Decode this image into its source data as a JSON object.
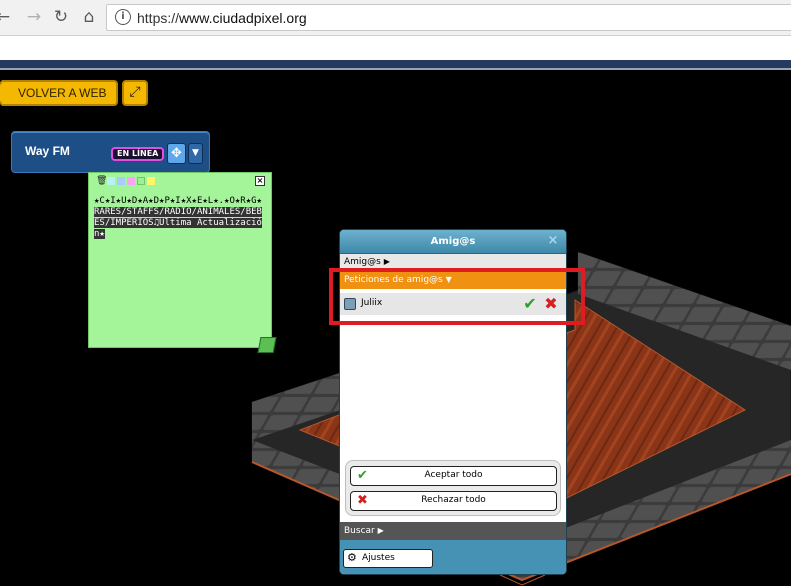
{
  "browser": {
    "back_icon": "arrow-left-icon",
    "forward_icon": "arrow-right-icon",
    "reload_icon": "reload-icon",
    "home_icon": "home-icon",
    "url_scheme": "https://",
    "url_host": "www.ciudadpixel.org"
  },
  "toolbar": {
    "back_to_web_label": "VOLVER A WEB",
    "expand_icon": "expand-arrows-icon"
  },
  "radio": {
    "station_name": "Way FM",
    "status_badge": "EN LÍNEA"
  },
  "note": {
    "line1": "★C★I★U★D★A★D★P★I★X★E★L★.★O★R★G★",
    "line2_highlight": "RARES/STAFFS/RADIO/ANIMALES/BEBES/IMPERIOS♫Ultima Actualización★",
    "swatch_colors": [
      "#b7f2f2",
      "#a9c9ff",
      "#f7a6f2",
      "#a4f59a",
      "#fdf46a"
    ]
  },
  "friends": {
    "title": "Amig@s",
    "section_friends": "Amig@s",
    "section_requests": "Peticiones de amig@s",
    "request_name": "Juliix",
    "accept_all": "Aceptar todo",
    "reject_all": "Rechazar todo",
    "section_search": "Buscar",
    "settings": "Ajustes"
  },
  "colors": {
    "highlight_red": "#e11b22",
    "requests_orange": "#f19112",
    "title_blue": "#4592b5"
  }
}
